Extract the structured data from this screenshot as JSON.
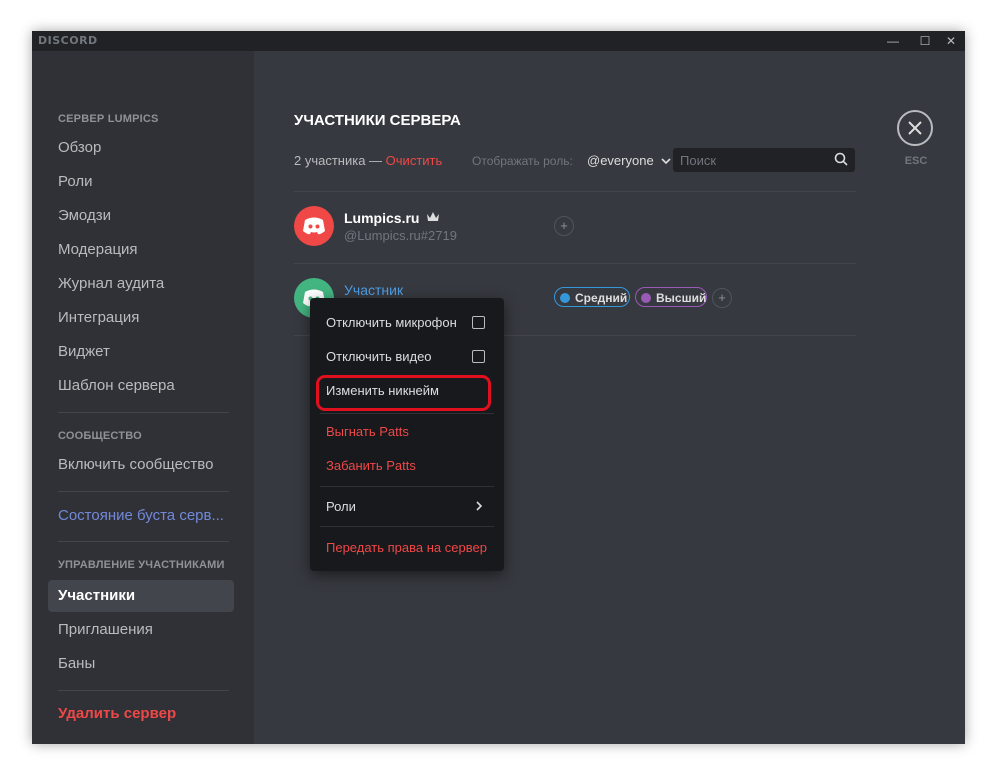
{
  "app": {
    "brand": "DISCORD"
  },
  "window_controls": {
    "minimize": "—",
    "maximize": "☐",
    "close": "✕"
  },
  "sidebar": {
    "server_header": "СЕРВЕР LUMPICS",
    "server_items": [
      "Обзор",
      "Роли",
      "Эмодзи",
      "Модерация",
      "Журнал аудита",
      "Интеграция",
      "Виджет",
      "Шаблон сервера"
    ],
    "community_header": "СООБЩЕСТВО",
    "community_item": "Включить сообщество",
    "boost_item": "Состояние буста серв...",
    "members_header": "УПРАВЛЕНИЕ УЧАСТНИКАМИ",
    "member_items": [
      "Участники",
      "Приглашения",
      "Баны"
    ],
    "delete_item": "Удалить сервер"
  },
  "main": {
    "title": "УЧАСТНИКИ СЕРВЕРА",
    "count_text": "2 участника — ",
    "clear_link": "Очистить",
    "role_filter_label": "Отображать роль:",
    "role_filter_value": "@everyone",
    "search_placeholder": "Поиск",
    "close_label": "ESC"
  },
  "members": [
    {
      "name": "Lumpics.ru",
      "tag": "@Lumpics.ru#2719",
      "owner": true,
      "avatar_color": "#f04747"
    },
    {
      "name": "Участник",
      "avatar_color": "#43b581",
      "roles": [
        {
          "name": "Средний",
          "color": "#3498db"
        },
        {
          "name": "Высший",
          "color": "#9b59b6"
        }
      ]
    }
  ],
  "context_menu": {
    "mute": "Отключить микрофон",
    "deafen_video": "Отключить видео",
    "change_nickname": "Изменить никнейм",
    "kick": "Выгнать Patts",
    "ban": "Забанить Patts",
    "roles": "Роли",
    "transfer": "Передать права на сервер"
  },
  "colors": {
    "accent_red": "#f04747",
    "accent_blue": "#7289da",
    "highlight": "#e0101e"
  }
}
